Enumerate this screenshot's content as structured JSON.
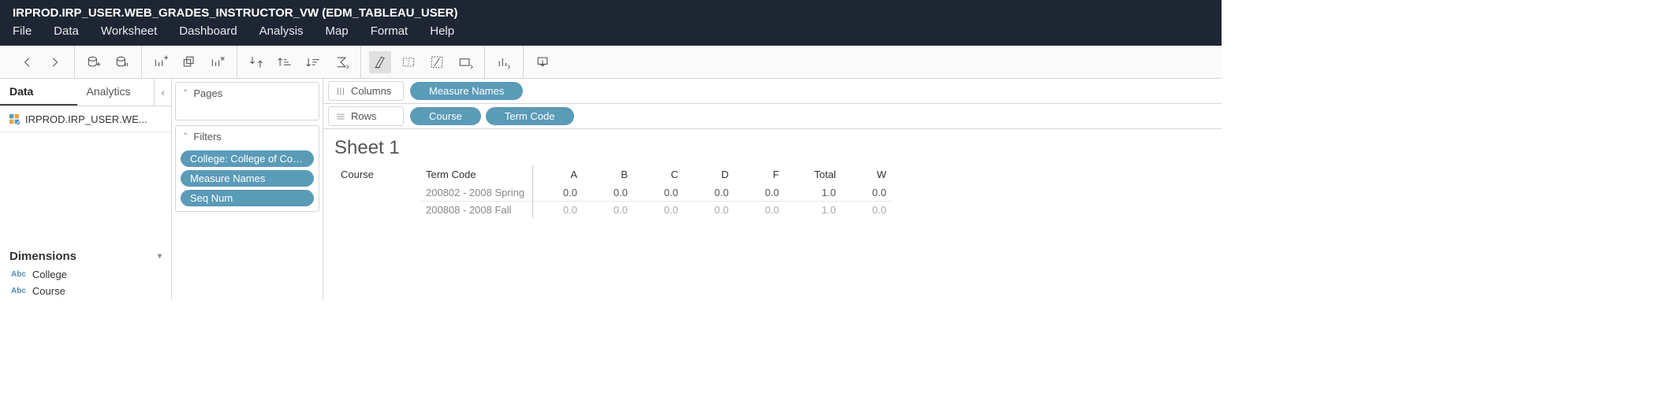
{
  "header": {
    "title": "IRPROD.IRP_USER.WEB_GRADES_INSTRUCTOR_VW (EDM_TABLEAU_USER)"
  },
  "menu": {
    "items": [
      "File",
      "Data",
      "Worksheet",
      "Dashboard",
      "Analysis",
      "Map",
      "Format",
      "Help"
    ]
  },
  "left_panel": {
    "tab_data": "Data",
    "tab_analytics": "Analytics",
    "datasource": "IRPROD.IRP_USER.WE...",
    "dimensions_label": "Dimensions",
    "fields": [
      "College",
      "Course"
    ]
  },
  "cards": {
    "pages_label": "Pages",
    "filters_label": "Filters",
    "filter_pills": [
      "College: College of Comp...",
      "Measure Names",
      "Seq Num"
    ]
  },
  "shelves": {
    "columns_label": "Columns",
    "rows_label": "Rows",
    "column_pills": [
      "Measure Names"
    ],
    "row_pills": [
      "Course",
      "Term Code"
    ]
  },
  "sheet": {
    "title": "Sheet 1",
    "row_headers": [
      "Course",
      "Term Code"
    ],
    "term_rows": [
      "200802 - 2008 Spring",
      "200808 - 2008 Fall"
    ],
    "columns": [
      "A",
      "B",
      "C",
      "D",
      "F",
      "Total",
      "W"
    ],
    "data": [
      [
        "0.0",
        "0.0",
        "0.0",
        "0.0",
        "0.0",
        "1.0",
        "0.0"
      ],
      [
        "0.0",
        "0.0",
        "0.0",
        "0.0",
        "0.0",
        "1.0",
        "0.0"
      ]
    ]
  }
}
